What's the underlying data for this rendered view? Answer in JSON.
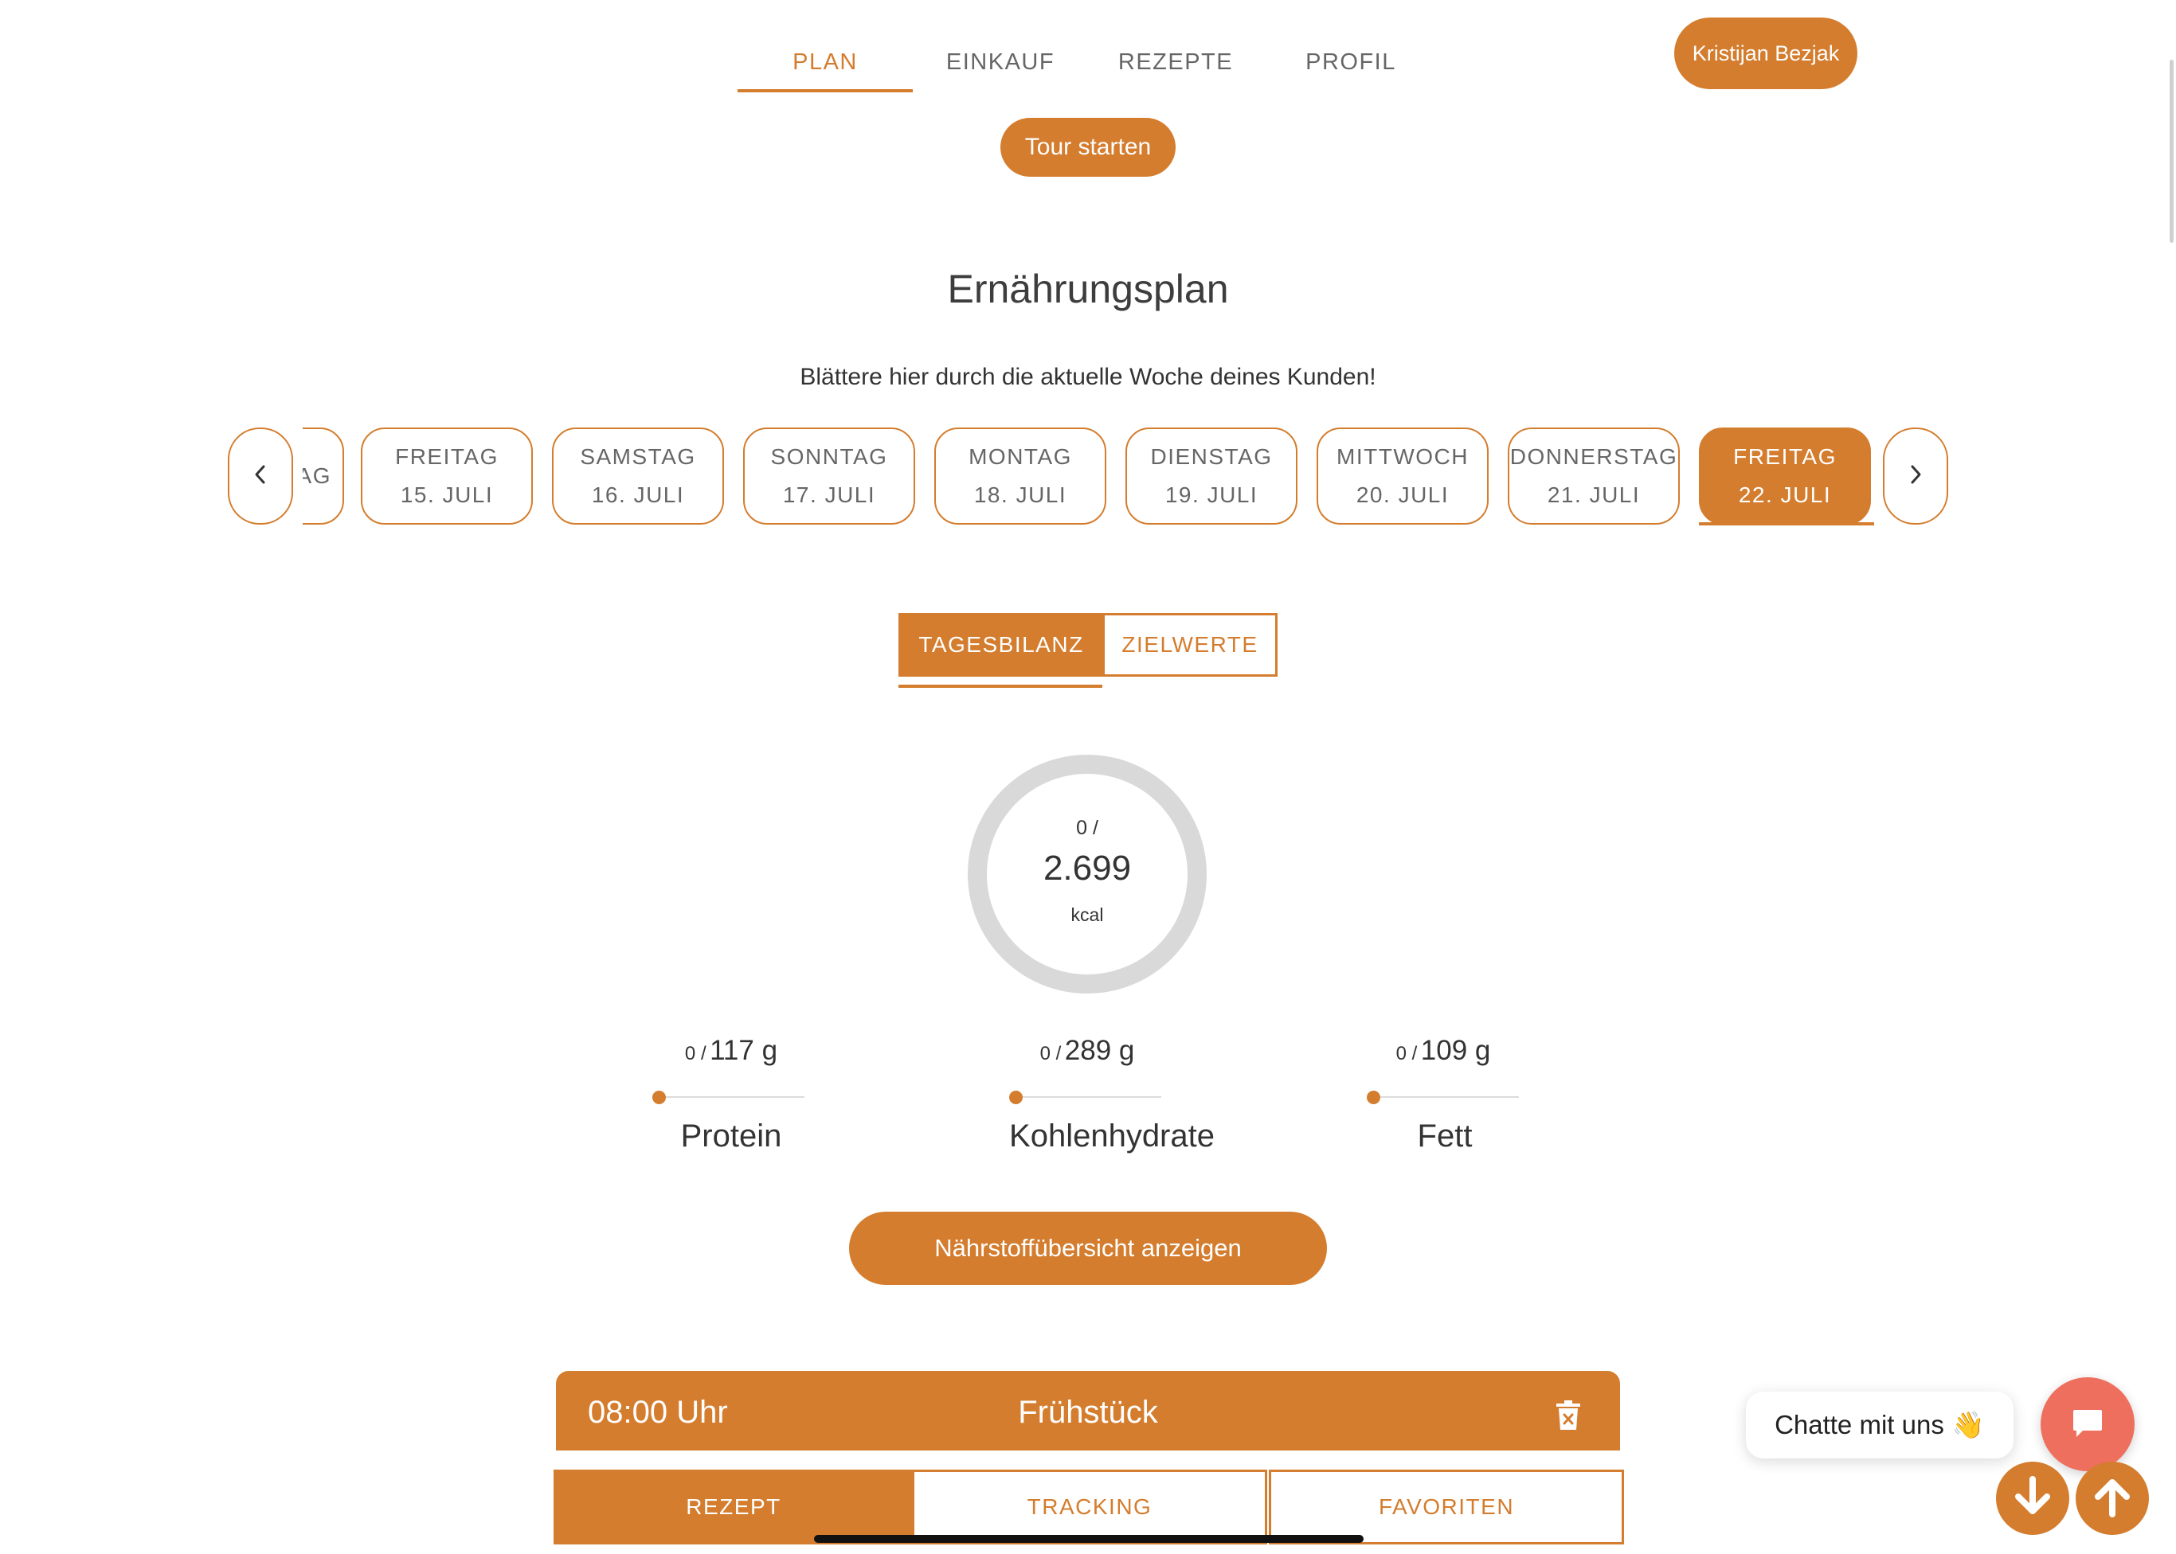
{
  "nav": {
    "tabs": [
      {
        "label": "PLAN"
      },
      {
        "label": "EINKAUF"
      },
      {
        "label": "REZEPTE"
      },
      {
        "label": "PROFIL"
      }
    ],
    "user_button": "Kristijan Bezjak"
  },
  "tour_button": "Tour starten",
  "page_title": "Ernährungsplan",
  "subtitle": "Blättere hier durch die aktuelle Woche deines Kunden!",
  "days": [
    {
      "weekday": "TAG",
      "date": ""
    },
    {
      "weekday": "FREITAG",
      "date": "15. JULI"
    },
    {
      "weekday": "SAMSTAG",
      "date": "16. JULI"
    },
    {
      "weekday": "SONNTAG",
      "date": "17. JULI"
    },
    {
      "weekday": "MONTAG",
      "date": "18. JULI"
    },
    {
      "weekday": "DIENSTAG",
      "date": "19. JULI"
    },
    {
      "weekday": "MITTWOCH",
      "date": "20. JULI"
    },
    {
      "weekday": "DONNERSTAG",
      "date": "21. JULI"
    },
    {
      "weekday": "FREITAG",
      "date": "22. JULI",
      "selected": true
    }
  ],
  "summary_tabs": {
    "daily_balance": "TAGESBILANZ",
    "targets": "ZIELWERTE"
  },
  "calories": {
    "current": "0 /",
    "target": "2.699",
    "unit": "kcal",
    "progress": 0
  },
  "macros": [
    {
      "current": "0 /",
      "target": "117 g",
      "name": "Protein",
      "progress": 0
    },
    {
      "current": "0 /",
      "target": "289 g",
      "name": "Kohlenhydrate",
      "progress": 0
    },
    {
      "current": "0 /",
      "target": "109 g",
      "name": "Fett",
      "progress": 0
    }
  ],
  "nutrient_button": "Nährstoffübersicht anzeigen",
  "meal": {
    "time": "08:00 Uhr",
    "name": "Frühstück",
    "tabs": {
      "recipe": "REZEPT",
      "tracking": "TRACKING",
      "favorites": "FAVORITEN"
    }
  },
  "chat": {
    "label": "Chatte mit uns",
    "emoji": "👋"
  },
  "colors": {
    "accent": "#d47d2e",
    "chat_button": "#ee6f5d",
    "ring_track": "#d9d9d9"
  }
}
